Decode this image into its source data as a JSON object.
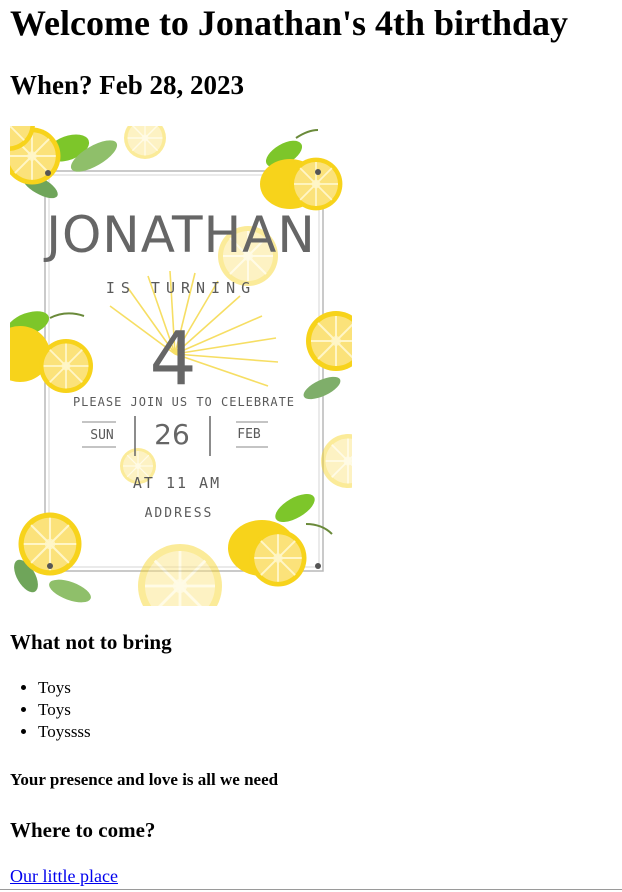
{
  "page": {
    "title": "Welcome to Jonathan's 4th birthday",
    "when": "When? Feb 28, 2023"
  },
  "invitation": {
    "name": "JONATHAN",
    "is_turning": "IS TURNING",
    "age": "4",
    "join_line": "PLEASE JOIN US TO CELEBRATE",
    "weekday": "SUN",
    "day": "26",
    "month": "FEB",
    "time": "AT 11 AM",
    "address": "ADDRESS",
    "colors": {
      "lemon": "#f7d31b",
      "lemon_slice": "#fbe27a",
      "leaf": "#7dc62a",
      "text": "#666666",
      "frame": "#b8b8b8",
      "rays": "#f5d94a"
    }
  },
  "not_to_bring": {
    "heading": "What not to bring",
    "items": [
      "Toys",
      "Toys",
      "Toyssss"
    ]
  },
  "presence_note": "Your presence and love is all we need",
  "where": {
    "heading": "Where to come?",
    "link_text": "Our little place"
  },
  "colors": {
    "link": "#0000ee",
    "text": "#000000"
  }
}
